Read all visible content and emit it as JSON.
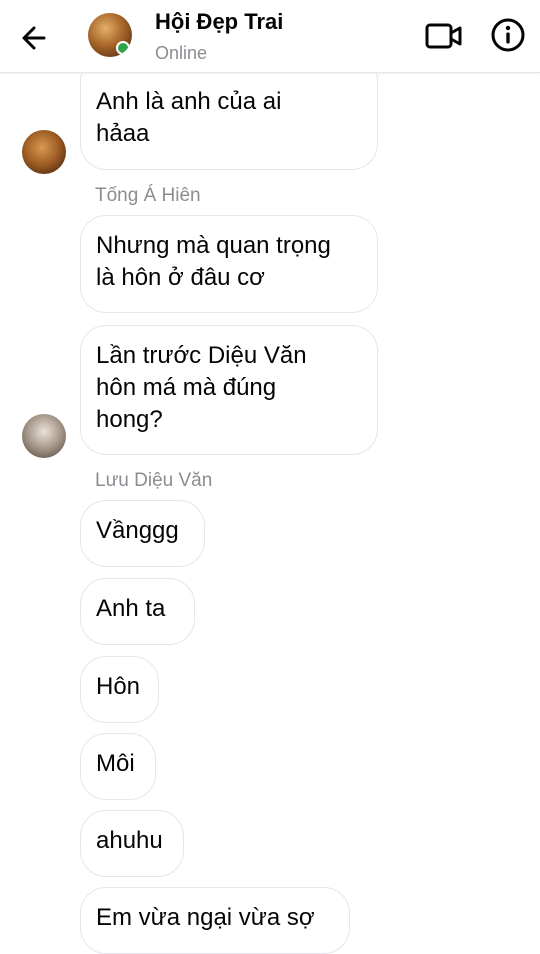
{
  "header": {
    "title": "Hội Đẹp Trai",
    "status": "Online"
  },
  "messages": [
    {
      "text": "Anh là anh của ai\nhảaa"
    },
    {
      "sender": "Tống Á Hiên"
    },
    {
      "text": "Nhưng mà quan trọng\nlà hôn ở đâu cơ"
    },
    {
      "text": "Lần trước Diệu Văn\nhôn má mà đúng\nhong?"
    },
    {
      "sender": "Lưu Diệu Văn"
    },
    {
      "text": "Vầnggg"
    },
    {
      "text": "Anh ta"
    },
    {
      "text": "Hôn"
    },
    {
      "text": "Môi"
    },
    {
      "text": "ahuhu"
    },
    {
      "text": "Em vừa ngại vừa sợ"
    }
  ],
  "colors": {
    "accent": "#050505",
    "secondary_text": "#8a8d91",
    "bubble_border": "#e4e6eb",
    "online": "#31a24c"
  },
  "icons": {
    "back": "arrow-left-icon",
    "video": "video-camera-icon",
    "info": "info-circle-icon"
  }
}
